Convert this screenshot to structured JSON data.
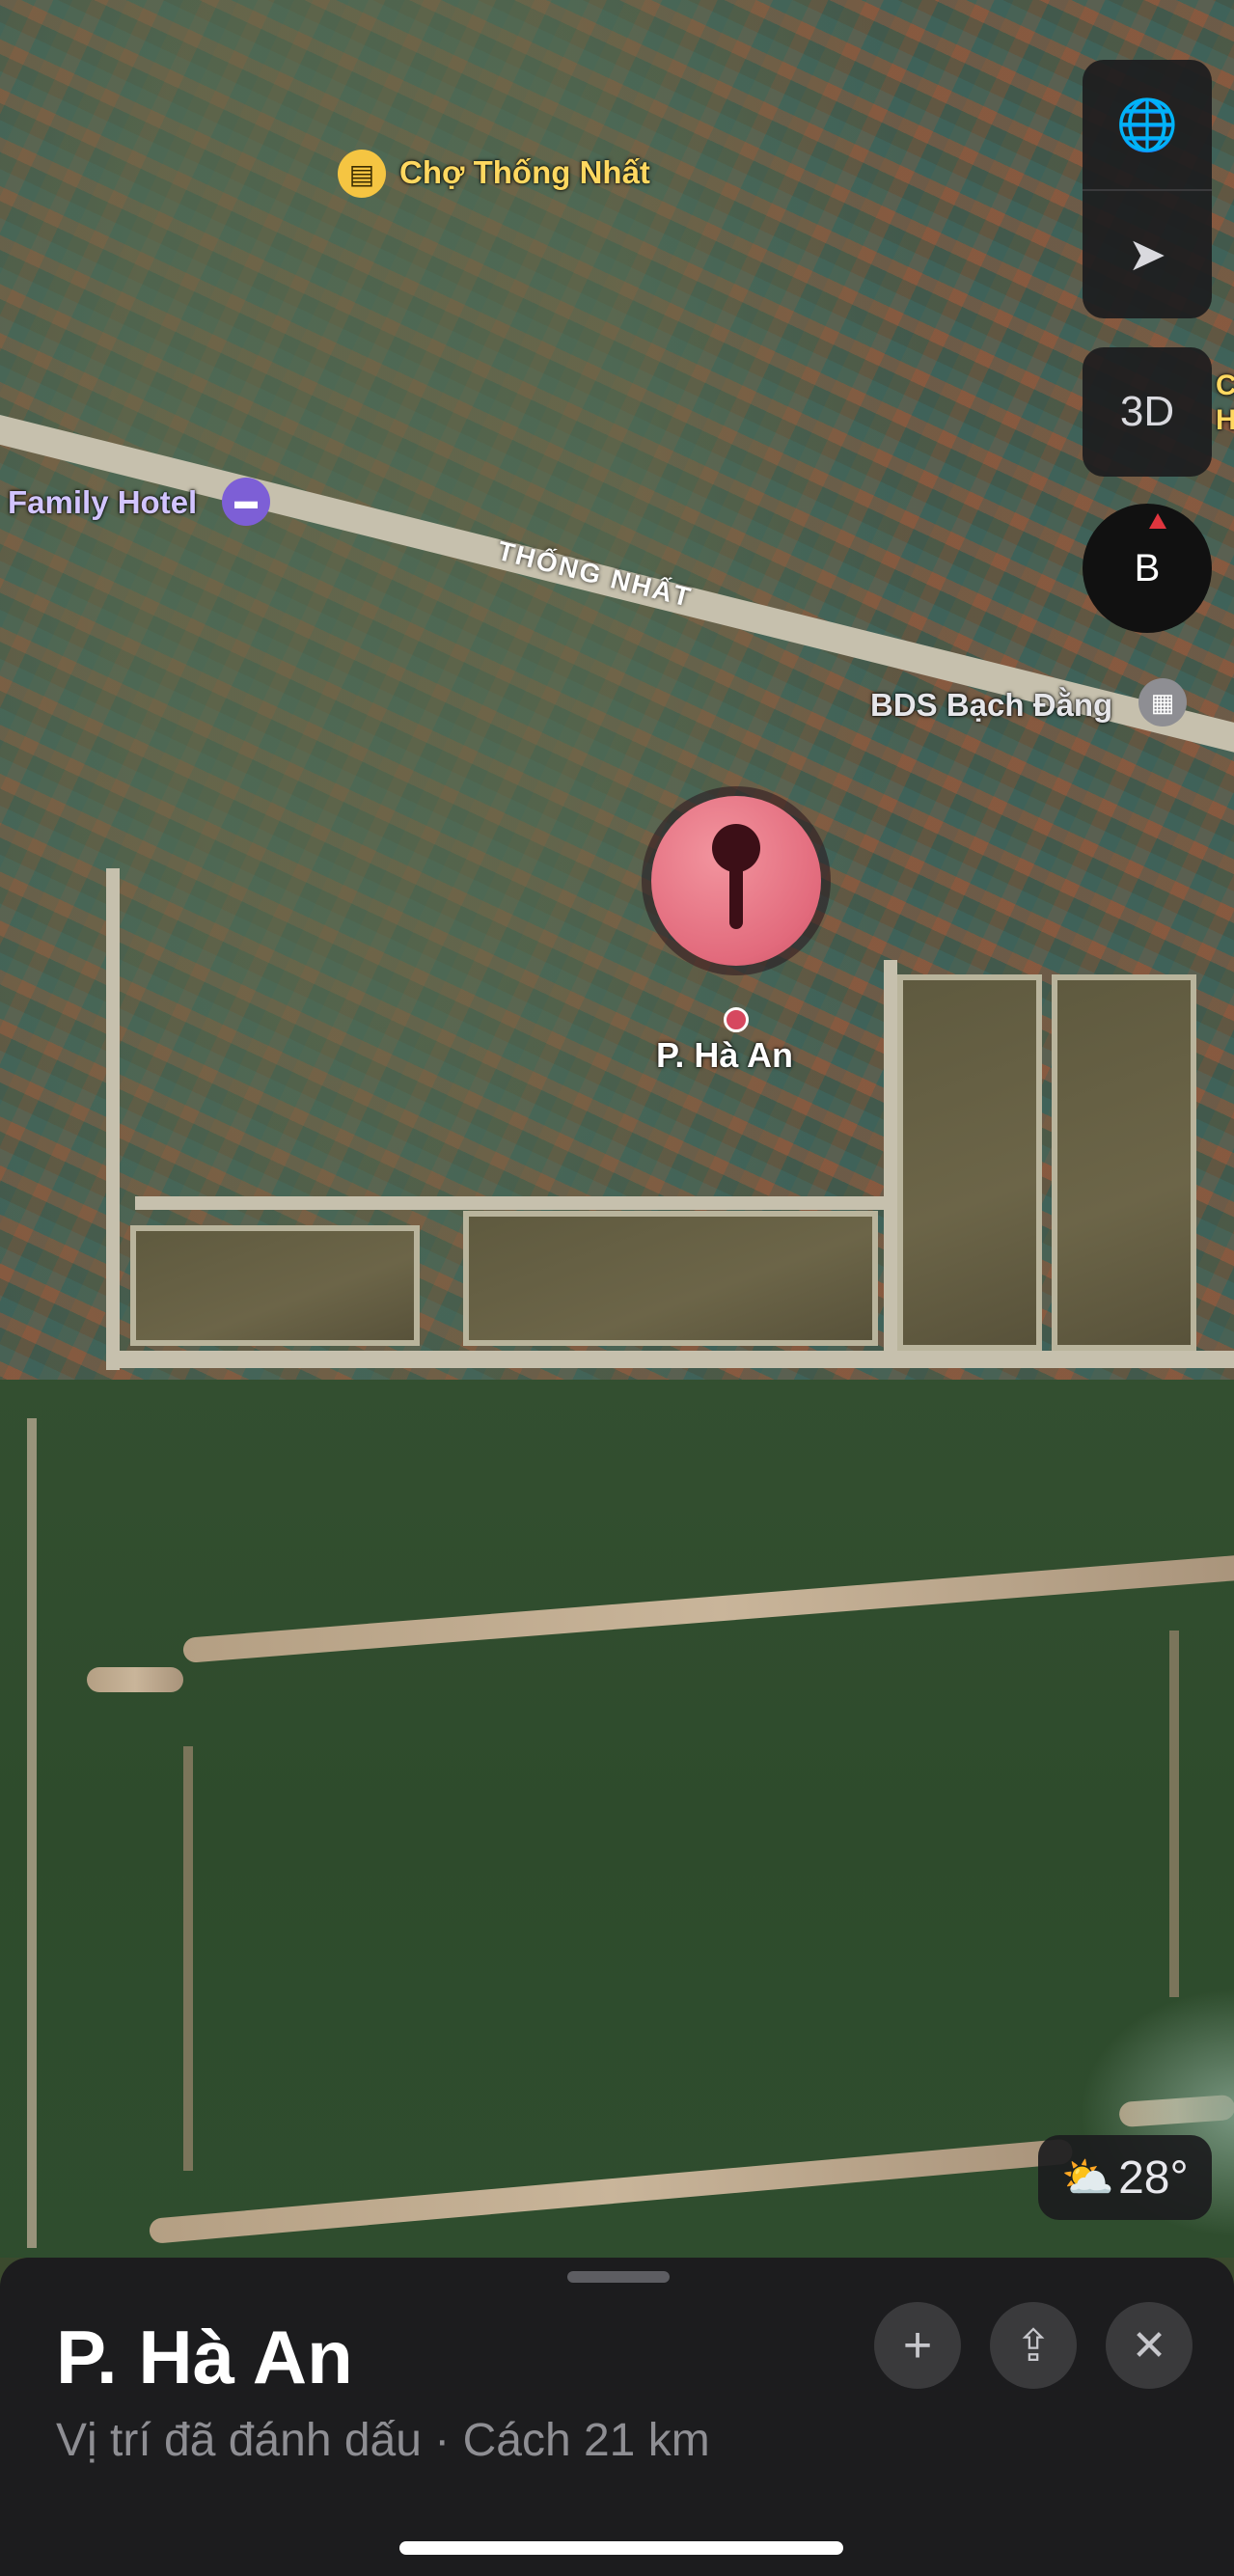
{
  "map": {
    "pois": {
      "market": {
        "name": "Chợ Thống Nhất",
        "icon": "shopping-bag-icon",
        "color": "#f5c542"
      },
      "hotel": {
        "name": "Family Hotel",
        "icon": "bed-icon",
        "color": "#7d5fd6"
      },
      "realestate": {
        "name": "BDS Bạch Đằng",
        "icon": "building-icon",
        "color": "#8e8e93"
      },
      "edge_label": "C\nH"
    },
    "road_name": "THỐNG NHẤT",
    "pin_label": "P. Hà An",
    "pin_color": "#e26a7c"
  },
  "controls": {
    "globe_icon": "🌐",
    "location_icon": "➤",
    "view_3d": "3D",
    "compass_letter": "B"
  },
  "weather": {
    "icon": "⛅",
    "temp": "28°"
  },
  "sheet": {
    "title": "P. Hà An",
    "subtitle": "Vị trí đã đánh dấu · Cách 21 km",
    "add_icon": "+",
    "share_icon": "⇪",
    "close_icon": "✕"
  }
}
